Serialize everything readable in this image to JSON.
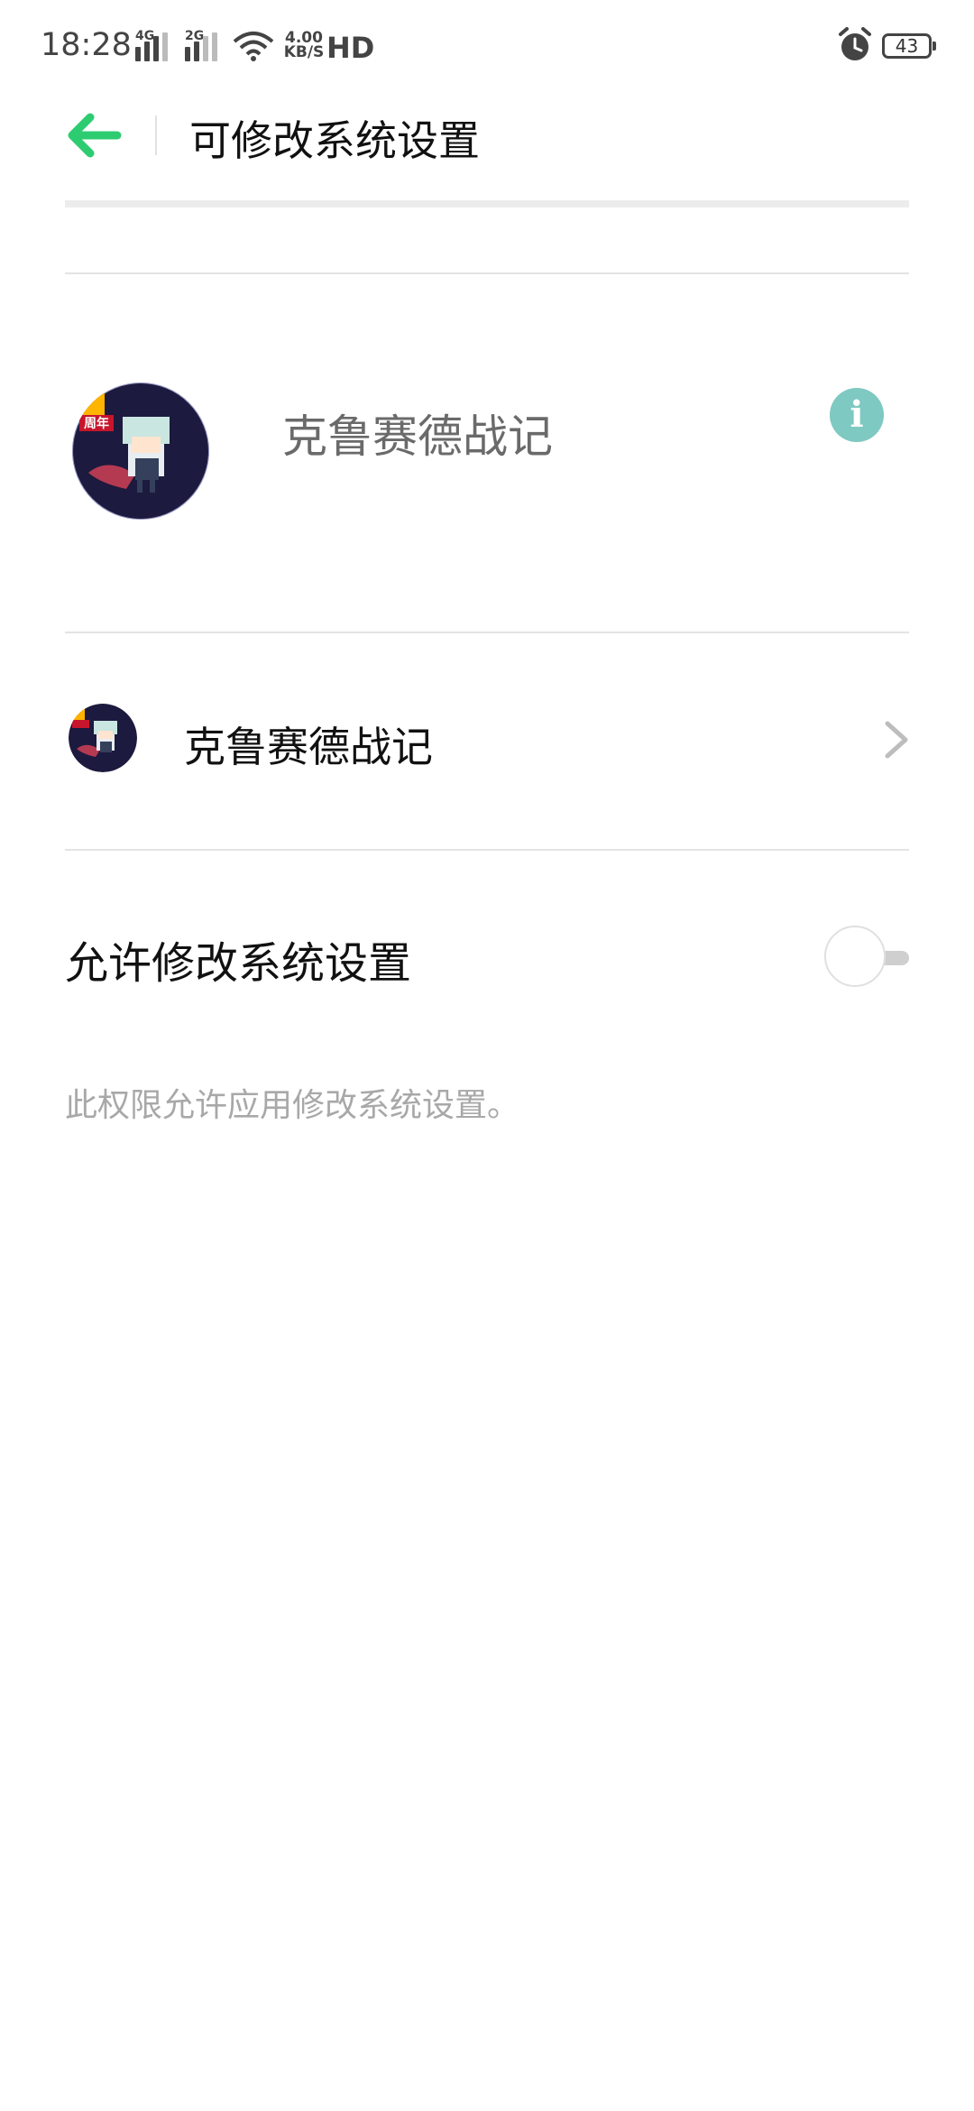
{
  "status_bar": {
    "time": "18:28",
    "signal1_label": "4G",
    "signal2_label": "2G",
    "net_speed_value": "4.00",
    "net_speed_unit": "KB/S",
    "hd_label": "HD",
    "battery": "43"
  },
  "header": {
    "title": "可修改系统设置",
    "back_icon": "arrow-left-icon",
    "accent_color": "#2ecc71"
  },
  "app": {
    "name": "克鲁赛德战记",
    "badge_text": "周年",
    "info_icon": "info-icon",
    "info_symbol": "i",
    "info_color": "#7ec9c1"
  },
  "app_row": {
    "label": "克鲁赛德战记"
  },
  "permission": {
    "label": "允许修改系统设置",
    "enabled": false,
    "description": "此权限允许应用修改系统设置。"
  }
}
